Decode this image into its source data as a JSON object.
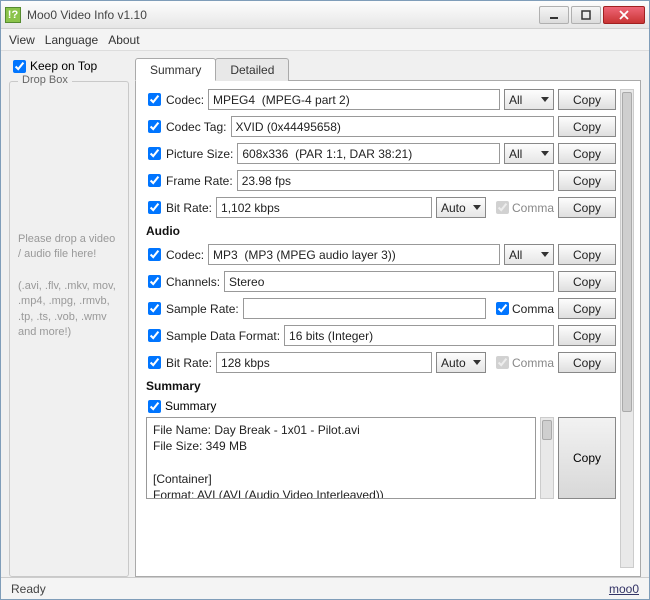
{
  "title": "Moo0 Video Info v1.10",
  "menu": {
    "view": "View",
    "language": "Language",
    "about": "About"
  },
  "keep_on_top": "Keep on Top",
  "dropbox": {
    "label": "Drop Box",
    "msg1": "Please drop a video / audio file here!",
    "msg2": "(.avi, .flv, .mkv, mov, .mp4, .mpg, .rmvb, .tp, .ts, .vob, .wmv and more!)"
  },
  "tabs": {
    "summary": "Summary",
    "detailed": "Detailed"
  },
  "rows": {
    "codec": {
      "label": "Codec:",
      "value": "MPEG4  (MPEG-4 part 2)",
      "sel": "All"
    },
    "codec_tag": {
      "label": "Codec Tag:",
      "value": "XVID (0x44495658)"
    },
    "picture_size": {
      "label": "Picture Size:",
      "value": "608x336  (PAR 1:1, DAR 38:21)",
      "sel": "All"
    },
    "frame_rate": {
      "label": "Frame Rate:",
      "value": "23.98 fps"
    },
    "bit_rate_v": {
      "label": "Bit Rate:",
      "value": "1,102 kbps",
      "sel": "Auto",
      "comma": "Comma"
    },
    "a_codec": {
      "label": "Codec:",
      "value": "MP3  (MP3 (MPEG audio layer 3))",
      "sel": "All"
    },
    "channels": {
      "label": "Channels:",
      "value": "Stereo"
    },
    "sample_rate": {
      "label": "Sample Rate:",
      "value": "",
      "comma": "Comma"
    },
    "sample_fmt": {
      "label": "Sample Data Format:",
      "value": "16 bits (Integer)"
    },
    "bit_rate_a": {
      "label": "Bit Rate:",
      "value": "128 kbps",
      "sel": "Auto",
      "comma": "Comma"
    }
  },
  "sections": {
    "audio": "Audio",
    "summary": "Summary"
  },
  "summary_check": "Summary",
  "summary_text": "File Name: Day Break - 1x01 - Pilot.avi\nFile Size: 349 MB\n\n[Container]\nFormat: AVI  (AVI (Audio Video Interleaved))",
  "copy": "Copy",
  "status": {
    "ready": "Ready",
    "link": "moo0"
  }
}
